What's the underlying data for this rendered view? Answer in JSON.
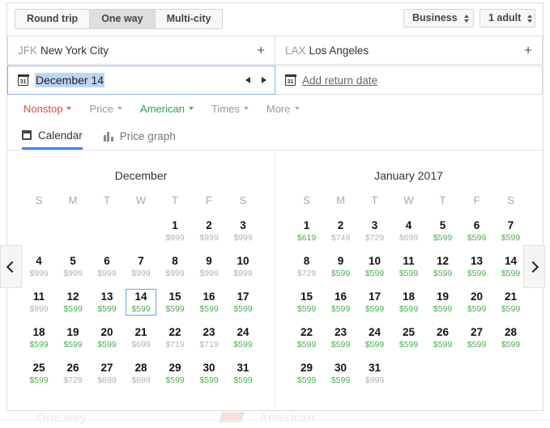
{
  "trip_types": [
    {
      "label": "Round trip",
      "active": false
    },
    {
      "label": "One way",
      "active": true
    },
    {
      "label": "Multi-city",
      "active": false
    }
  ],
  "cabin": {
    "value": "Business"
  },
  "passengers": {
    "value": "1 adult"
  },
  "origin": {
    "code": "JFK",
    "city": "New York City",
    "add_label": "+"
  },
  "destination": {
    "code": "LAX",
    "city": "Los Angeles",
    "add_label": "+"
  },
  "depart_date": {
    "icon_label": "31",
    "value": "December 14"
  },
  "return_date": {
    "icon_label": "31",
    "placeholder": "Add return date"
  },
  "filters": [
    {
      "label": "Nonstop",
      "color": "red"
    },
    {
      "label": "Price",
      "color": "gray"
    },
    {
      "label": "American",
      "color": "green"
    },
    {
      "label": "Times",
      "color": "gray"
    },
    {
      "label": "More",
      "color": "gray"
    }
  ],
  "tabs": [
    {
      "label": "Calendar",
      "icon": "calendar-icon",
      "active": true
    },
    {
      "label": "Price graph",
      "icon": "bar-chart-icon",
      "active": false
    }
  ],
  "nav": {
    "prev": "chevron-left-icon",
    "next": "chevron-right-icon"
  },
  "weekday_headers": [
    "S",
    "M",
    "T",
    "W",
    "T",
    "F",
    "S"
  ],
  "colors": {
    "cheap_price": "#4caf50",
    "normal_price": "#b3b3b3",
    "accent": "#4285f4",
    "filter_red": "#e8453c",
    "filter_green": "#28a745"
  },
  "calendars": [
    {
      "title": "December",
      "lead_blanks": 4,
      "days": [
        {
          "day": 1,
          "price": "$999",
          "cheap": false
        },
        {
          "day": 2,
          "price": "$999",
          "cheap": false
        },
        {
          "day": 3,
          "price": "$999",
          "cheap": false
        },
        {
          "day": 4,
          "price": "$999",
          "cheap": false
        },
        {
          "day": 5,
          "price": "$999",
          "cheap": false
        },
        {
          "day": 6,
          "price": "$999",
          "cheap": false
        },
        {
          "day": 7,
          "price": "$999",
          "cheap": false
        },
        {
          "day": 8,
          "price": "$999",
          "cheap": false
        },
        {
          "day": 9,
          "price": "$999",
          "cheap": false
        },
        {
          "day": 10,
          "price": "$999",
          "cheap": false
        },
        {
          "day": 11,
          "price": "$999",
          "cheap": false
        },
        {
          "day": 12,
          "price": "$599",
          "cheap": true
        },
        {
          "day": 13,
          "price": "$599",
          "cheap": true
        },
        {
          "day": 14,
          "price": "$599",
          "cheap": true,
          "selected": true
        },
        {
          "day": 15,
          "price": "$599",
          "cheap": true
        },
        {
          "day": 16,
          "price": "$599",
          "cheap": true
        },
        {
          "day": 17,
          "price": "$599",
          "cheap": true
        },
        {
          "day": 18,
          "price": "$599",
          "cheap": true
        },
        {
          "day": 19,
          "price": "$599",
          "cheap": true
        },
        {
          "day": 20,
          "price": "$599",
          "cheap": true
        },
        {
          "day": 21,
          "price": "$699",
          "cheap": false
        },
        {
          "day": 22,
          "price": "$719",
          "cheap": false
        },
        {
          "day": 23,
          "price": "$719",
          "cheap": false
        },
        {
          "day": 24,
          "price": "$599",
          "cheap": true
        },
        {
          "day": 25,
          "price": "$599",
          "cheap": true
        },
        {
          "day": 26,
          "price": "$729",
          "cheap": false
        },
        {
          "day": 27,
          "price": "$699",
          "cheap": false
        },
        {
          "day": 28,
          "price": "$699",
          "cheap": false
        },
        {
          "day": 29,
          "price": "$599",
          "cheap": true
        },
        {
          "day": 30,
          "price": "$599",
          "cheap": true
        },
        {
          "day": 31,
          "price": "$599",
          "cheap": true
        }
      ]
    },
    {
      "title": "January 2017",
      "lead_blanks": 0,
      "days": [
        {
          "day": 1,
          "price": "$619",
          "cheap": true
        },
        {
          "day": 2,
          "price": "$749",
          "cheap": false
        },
        {
          "day": 3,
          "price": "$729",
          "cheap": false
        },
        {
          "day": 4,
          "price": "$699",
          "cheap": false
        },
        {
          "day": 5,
          "price": "$599",
          "cheap": true
        },
        {
          "day": 6,
          "price": "$599",
          "cheap": true
        },
        {
          "day": 7,
          "price": "$599",
          "cheap": true
        },
        {
          "day": 8,
          "price": "$729",
          "cheap": false
        },
        {
          "day": 9,
          "price": "$599",
          "cheap": true
        },
        {
          "day": 10,
          "price": "$599",
          "cheap": true
        },
        {
          "day": 11,
          "price": "$599",
          "cheap": true
        },
        {
          "day": 12,
          "price": "$599",
          "cheap": true
        },
        {
          "day": 13,
          "price": "$599",
          "cheap": true
        },
        {
          "day": 14,
          "price": "$599",
          "cheap": true
        },
        {
          "day": 15,
          "price": "$599",
          "cheap": true
        },
        {
          "day": 16,
          "price": "$599",
          "cheap": true
        },
        {
          "day": 17,
          "price": "$599",
          "cheap": true
        },
        {
          "day": 18,
          "price": "$599",
          "cheap": true
        },
        {
          "day": 19,
          "price": "$599",
          "cheap": true
        },
        {
          "day": 20,
          "price": "$599",
          "cheap": true
        },
        {
          "day": 21,
          "price": "$599",
          "cheap": true
        },
        {
          "day": 22,
          "price": "$599",
          "cheap": true
        },
        {
          "day": 23,
          "price": "$599",
          "cheap": true
        },
        {
          "day": 24,
          "price": "$599",
          "cheap": true
        },
        {
          "day": 25,
          "price": "$599",
          "cheap": true
        },
        {
          "day": 26,
          "price": "$599",
          "cheap": true
        },
        {
          "day": 27,
          "price": "$599",
          "cheap": true
        },
        {
          "day": 28,
          "price": "$599",
          "cheap": true
        },
        {
          "day": 29,
          "price": "$599",
          "cheap": true
        },
        {
          "day": 30,
          "price": "$599",
          "cheap": true
        },
        {
          "day": 31,
          "price": "$999",
          "cheap": false
        }
      ]
    }
  ],
  "watermark": {
    "left_text": "One way",
    "right_text": "American"
  }
}
